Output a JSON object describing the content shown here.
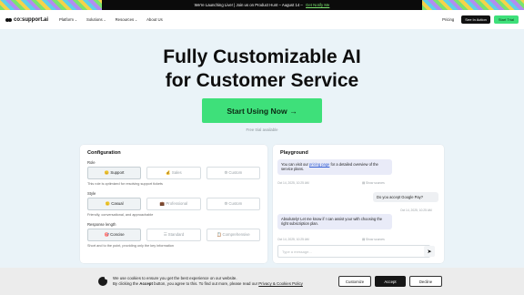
{
  "announcement": {
    "message": "We're Launching Live! | Join us on Product Hunt – August 14 –",
    "cta": "Get Notify Me"
  },
  "nav": {
    "brand": "co:support.ai",
    "items": [
      "Platform",
      "Solutions",
      "Resources",
      "About Us"
    ],
    "pricing": "Pricing",
    "see_in_action": "See In Action",
    "start_trial": "Start Trial"
  },
  "hero": {
    "title_line1": "Fully Customizable AI",
    "title_line2": "for Customer Service",
    "cta": "Start Using Now →",
    "note": "Free trial available"
  },
  "config": {
    "title": "Configuration",
    "role": {
      "label": "Role",
      "options": [
        "😊 Support",
        "💰 Sales",
        "⚙ Custom"
      ],
      "selected": "😊 Support",
      "description": "This role is optimized for resolving support tickets"
    },
    "style": {
      "label": "Style",
      "options": [
        "🙂 Casual",
        "💼 Professional",
        "⚙ Custom"
      ],
      "selected": "🙂 Casual",
      "description": "Friendly, conversational, and approachable"
    },
    "length": {
      "label": "Response length",
      "options": [
        "🎯 Concise",
        "☰ Standard",
        "📋 Comprehensive"
      ],
      "selected": "🎯 Concise",
      "description": "Short and to the point, providing only the key information"
    }
  },
  "playground": {
    "title": "Playground",
    "msg1_pre": "You can visit our ",
    "msg1_link": "pricing page",
    "msg1_post": " for a detailed overview of the service plans.",
    "msg1_time": "Oct 14, 2025, 10:25 AM",
    "show_sources": "Show sources",
    "msg2": "Do you accept Google Pay?",
    "msg2_time": "Oct 14, 2025, 10:25 AM",
    "msg3": "Absolutely! Let me know if I can assist your with choosing the right subscription plan.",
    "msg3_time": "Oct 14, 2025, 10:25 AM",
    "input_placeholder": "Type a message...",
    "send_icon": "send-icon"
  },
  "cookie": {
    "line1": "We use cookies to ensure you get the best experience on our website.",
    "line2_pre": "By clicking the ",
    "line2_bold": "Accept",
    "line2_mid": " button, you agree to this. To find out more, please read our ",
    "line2_link": "Privacy & Cookies Policy",
    "customize": "Customize",
    "accept": "Accept",
    "decline": "Decline"
  }
}
